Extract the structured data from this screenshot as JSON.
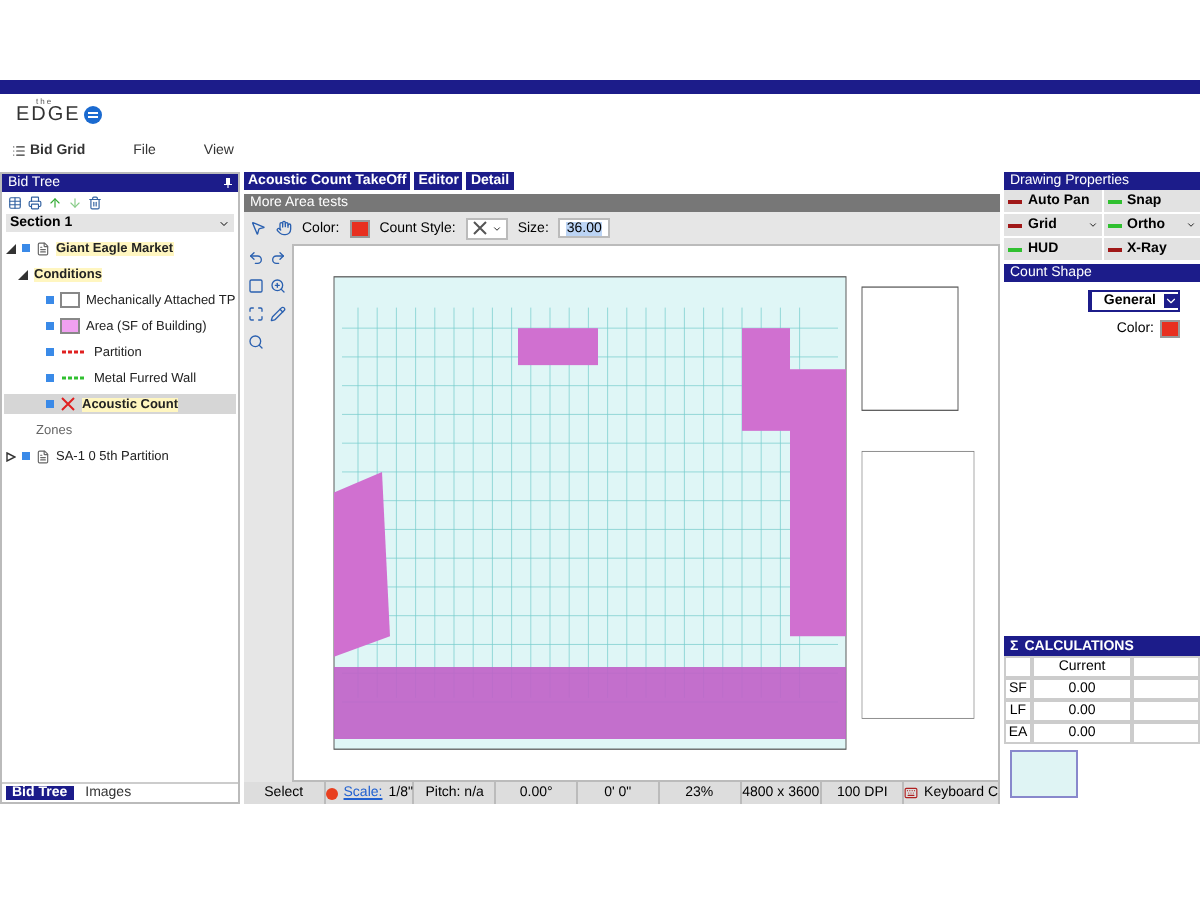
{
  "app": {
    "logo_small": "the",
    "logo": "EDGE"
  },
  "menu": [
    {
      "label": "Bid Grid",
      "kind": "grid"
    },
    {
      "label": "File",
      "kind": "plain"
    },
    {
      "label": "View",
      "kind": "plain"
    }
  ],
  "bid_tree": {
    "title": "Bid Tree",
    "section": "Section 1",
    "tree": [
      {
        "label": "Giant Eagle Market",
        "expanded": true,
        "highlighted": true,
        "checked": true,
        "children": [
          {
            "label": "Conditions",
            "expanded": true,
            "highlighted": true,
            "children": [
              {
                "label": "Mechanically Attached TP",
                "kind": "area",
                "color": "#ffffff",
                "selected": false,
                "highlighted": false,
                "checked": true
              },
              {
                "label": "Area (SF of Building)",
                "kind": "area",
                "color": "#f0a0f0",
                "selected": false,
                "highlighted": false,
                "checked": true
              },
              {
                "label": "Partition",
                "kind": "linear",
                "color": "#e02020",
                "selected": false,
                "highlighted": false,
                "checked": true
              },
              {
                "label": "Metal Furred Wall",
                "kind": "linear",
                "color": "#30c030",
                "selected": false,
                "highlighted": false,
                "checked": true
              },
              {
                "label": "Acoustic Count",
                "kind": "count",
                "color": "#e02020",
                "selected": true,
                "highlighted": true,
                "checked": true
              }
            ]
          }
        ]
      },
      {
        "label": "Zones",
        "kind": "heading"
      },
      {
        "label": "SA-1 0 5th Partition",
        "expanded": false,
        "highlighted": false,
        "checked": true
      }
    ],
    "tabs": [
      {
        "label": "Bid Tree",
        "selected": true
      },
      {
        "label": "Images",
        "selected": false
      }
    ]
  },
  "editor": {
    "tabs": [
      {
        "label": "Acoustic Count TakeOff"
      },
      {
        "label": "Editor"
      },
      {
        "label": "Detail"
      }
    ],
    "title": "More Area tests",
    "color_label": "Color:",
    "color": "#e83020",
    "style_label": "Count Style:",
    "size_label": "Size:",
    "size": "36.00"
  },
  "status_bar": [
    {
      "label": "Select",
      "kind": "text"
    },
    {
      "label": "Scale:",
      "kind": "scale",
      "value": "1/8\""
    },
    {
      "label": "Pitch: n/a",
      "kind": "text"
    },
    {
      "label": "0.00°",
      "kind": "text"
    },
    {
      "label": "0' 0\"",
      "kind": "text"
    },
    {
      "label": "23%",
      "kind": "text"
    },
    {
      "label": "4800 x 3600",
      "kind": "text"
    },
    {
      "label": "100 DPI",
      "kind": "text"
    },
    {
      "label": "Keyboard C",
      "kind": "keyboard"
    }
  ],
  "drawing_properties": {
    "title": "Drawing Properties",
    "toggles": [
      {
        "label": "Auto Pan",
        "on": false,
        "dropdown": false
      },
      {
        "label": "Snap",
        "on": true,
        "dropdown": false
      },
      {
        "label": "Grid",
        "on": false,
        "dropdown": true
      },
      {
        "label": "Ortho",
        "on": true,
        "dropdown": true
      },
      {
        "label": "HUD",
        "on": true,
        "dropdown": false
      },
      {
        "label": "X-Ray",
        "on": false,
        "dropdown": false
      }
    ]
  },
  "count_shape": {
    "title": "Count Shape",
    "shape": "General",
    "color_label": "Color:",
    "color": "#e83020"
  },
  "calculations": {
    "title": "CALCULATIONS",
    "icon": "Σ",
    "columns": [
      "Current"
    ],
    "rows": [
      {
        "label": "SF",
        "value": "0.00"
      },
      {
        "label": "LF",
        "value": "0.00"
      },
      {
        "label": "EA",
        "value": "0.00"
      }
    ]
  }
}
